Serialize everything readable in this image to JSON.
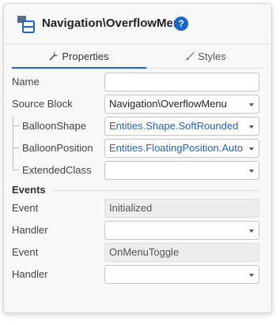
{
  "header": {
    "title": "Navigation\\OverflowMenu",
    "help_glyph": "?",
    "icon": "block-icon"
  },
  "tabs": [
    {
      "label": "Properties",
      "icon": "wrench-icon",
      "active": true
    },
    {
      "label": "Styles",
      "icon": "brush-icon",
      "active": false
    }
  ],
  "properties": {
    "name": {
      "label": "Name",
      "value": ""
    },
    "source_block": {
      "label": "Source Block",
      "value": "Navigation\\OverflowMenu"
    },
    "balloon_shape": {
      "label": "BalloonShape",
      "value": "Entities.Shape.SoftRounded"
    },
    "balloon_position": {
      "label": "BalloonPosition",
      "value": "Entities.FloatingPosition.Auto"
    },
    "extended_class": {
      "label": "ExtendedClass",
      "value": ""
    }
  },
  "events": {
    "title": "Events",
    "items": [
      {
        "event_label": "Event",
        "event_value": "Initialized",
        "handler_label": "Handler",
        "handler_value": ""
      },
      {
        "event_label": "Event",
        "event_value": "OnMenuToggle",
        "handler_label": "Handler",
        "handler_value": ""
      }
    ]
  },
  "colors": {
    "accent": "#1b66c9",
    "expression_text": "#1b66c9",
    "panel_bg": "#f8f8f8",
    "readonly_bg": "#ececec"
  }
}
